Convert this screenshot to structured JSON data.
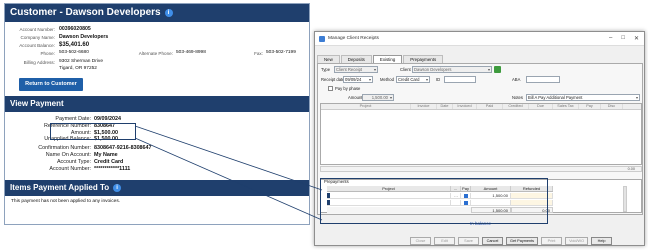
{
  "customer": {
    "title": "Customer - Dawson Developers",
    "account_number_label": "Account Number:",
    "account_number": "00396020805",
    "company_name_label": "Company Name:",
    "company_name": "Dawson Developers",
    "account_balance_label": "Account Balance:",
    "account_balance": "$35,401.60",
    "phone_label": "Phone:",
    "phone": "503-502-6680",
    "alt_phone_label": "Alternate Phone:",
    "alt_phone": "503-469-8998",
    "fax_label": "Fax:",
    "fax": "503-502-7199",
    "billing_label": "Billing Address:",
    "billing_line1": "9302 Sherman Drive",
    "billing_line2": "Tigard, OR 97252",
    "return_button": "Return to Customer"
  },
  "view_payment": {
    "header": "View Payment",
    "rows": [
      {
        "label": "Payment Date:",
        "value": "09/09/2024"
      },
      {
        "label": "Reference Number:",
        "value": "8308647"
      },
      {
        "label": "Amount:",
        "value": "$1,500.00"
      },
      {
        "label": "Unapplied Balance:",
        "value": "$1,500.00"
      },
      {
        "label": "Confirmation Number:",
        "value": "8308647-9216-8308647"
      },
      {
        "label": "Name On Account:",
        "value": "My Name"
      },
      {
        "label": "Account Type:",
        "value": "Credit Card"
      },
      {
        "label": "Account Number:",
        "value": "************1111"
      }
    ]
  },
  "items_applied": {
    "header": "Items Payment Applied To",
    "message": "This payment has not been applied to any invoices."
  },
  "dialog": {
    "title": "Manage Client Receipts",
    "tabs": [
      "New",
      "Deposits",
      "Existing",
      "Prepayments"
    ],
    "active_tab": "Existing",
    "type_label": "Type",
    "type_value": "Client Receipt",
    "client_label": "Client",
    "client_value": "Dawson Developers",
    "receipt_date_label": "Receipt date",
    "receipt_date": "09/09/24",
    "method_label": "Method",
    "method_value": "Credit Card",
    "id_label": "ID",
    "aba_label": "ABA",
    "pay_by_phase_label": "Pay by phase",
    "amount_label": "Amount",
    "amount_value": "1,500.00",
    "notes_label": "Notes",
    "notes_value": "Bill A Pay Additional Payment",
    "grid_headers": [
      "Project",
      "Invoice",
      "Date",
      "Invoiced",
      "Paid",
      "Credited",
      "Due",
      "Sales Tax",
      "Pay",
      "Disc"
    ],
    "grid_total": "0.00",
    "prepayments_label": "Prepayments",
    "prep_headers": [
      "Project",
      "...",
      "Pay",
      "Amount",
      "Refunded"
    ],
    "prep_rows": [
      {
        "amount": "1,500.00",
        "refunded": ""
      },
      {
        "amount": "",
        "refunded": ""
      }
    ],
    "prep_total_amount": "1,500.00",
    "prep_total_refunded": "0.00",
    "in_balance": "In balance",
    "buttons": [
      "Close",
      "Edit",
      "Save",
      "Cancel",
      "Get Payments",
      "Print",
      "Void/WO",
      "Help"
    ]
  }
}
